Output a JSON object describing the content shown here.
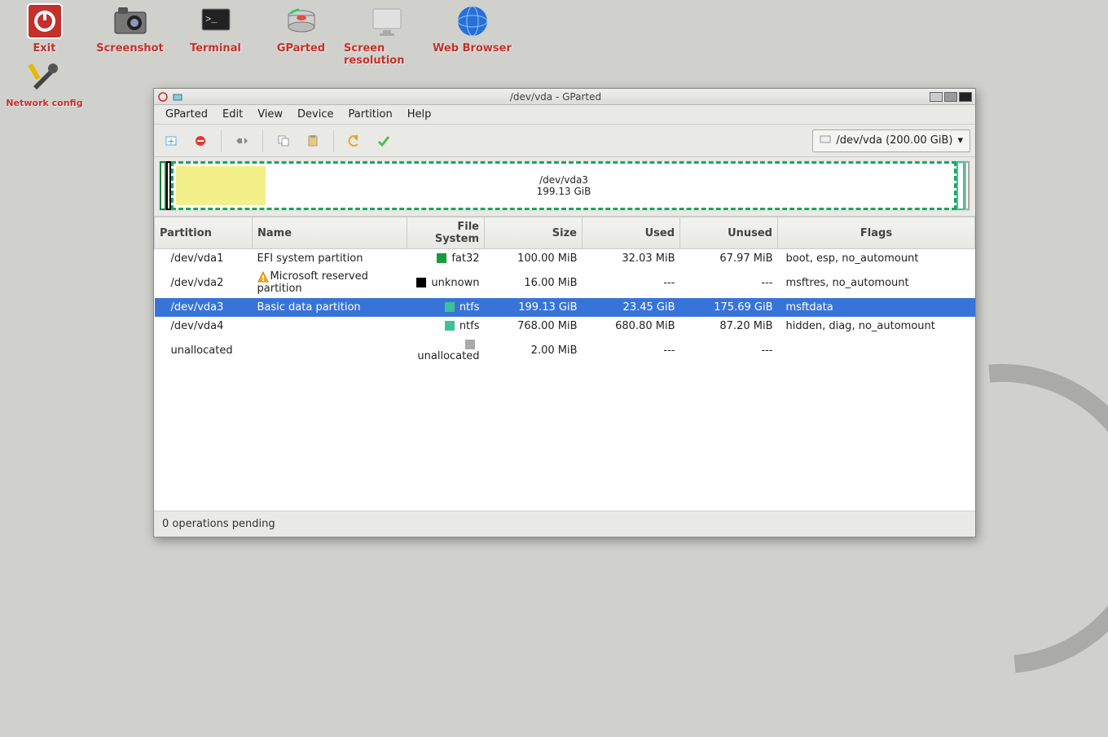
{
  "desktop": {
    "icons": [
      {
        "label": "Exit"
      },
      {
        "label": "Screenshot"
      },
      {
        "label": "Terminal"
      },
      {
        "label": "GParted"
      },
      {
        "label": "Screen resolution"
      },
      {
        "label": "Web Browser"
      }
    ],
    "net_label": "Network config"
  },
  "window": {
    "title": "/dev/vda - GParted",
    "menus": [
      "GParted",
      "Edit",
      "View",
      "Device",
      "Partition",
      "Help"
    ],
    "device_selector": "/dev/vda (200.00 GiB)",
    "main_partition": {
      "name": "/dev/vda3",
      "size": "199.13 GiB"
    },
    "columns": [
      "Partition",
      "Name",
      "File System",
      "Size",
      "Used",
      "Unused",
      "Flags"
    ],
    "rows": [
      {
        "partition": "/dev/vda1",
        "name": "EFI system partition",
        "fs": "fat32",
        "fscolor": "#1a9b3a",
        "size": "100.00 MiB",
        "used": "32.03 MiB",
        "unused": "67.97 MiB",
        "flags": "boot, esp, no_automount",
        "warn": false
      },
      {
        "partition": "/dev/vda2",
        "name": "Microsoft reserved partition",
        "fs": "unknown",
        "fscolor": "#000000",
        "size": "16.00 MiB",
        "used": "---",
        "unused": "---",
        "flags": "msftres, no_automount",
        "warn": true
      },
      {
        "partition": "/dev/vda3",
        "name": "Basic data partition",
        "fs": "ntfs",
        "fscolor": "#3fc19a",
        "size": "199.13 GiB",
        "used": "23.45 GiB",
        "unused": "175.69 GiB",
        "flags": "msftdata",
        "warn": false,
        "selected": true
      },
      {
        "partition": "/dev/vda4",
        "name": "",
        "fs": "ntfs",
        "fscolor": "#3fc19a",
        "size": "768.00 MiB",
        "used": "680.80 MiB",
        "unused": "87.20 MiB",
        "flags": "hidden, diag, no_automount",
        "warn": false
      },
      {
        "partition": "unallocated",
        "name": "",
        "fs": "unallocated",
        "fscolor": "#a9a9a9",
        "size": "2.00 MiB",
        "used": "---",
        "unused": "---",
        "flags": "",
        "warn": false
      }
    ],
    "status": "0 operations pending"
  }
}
